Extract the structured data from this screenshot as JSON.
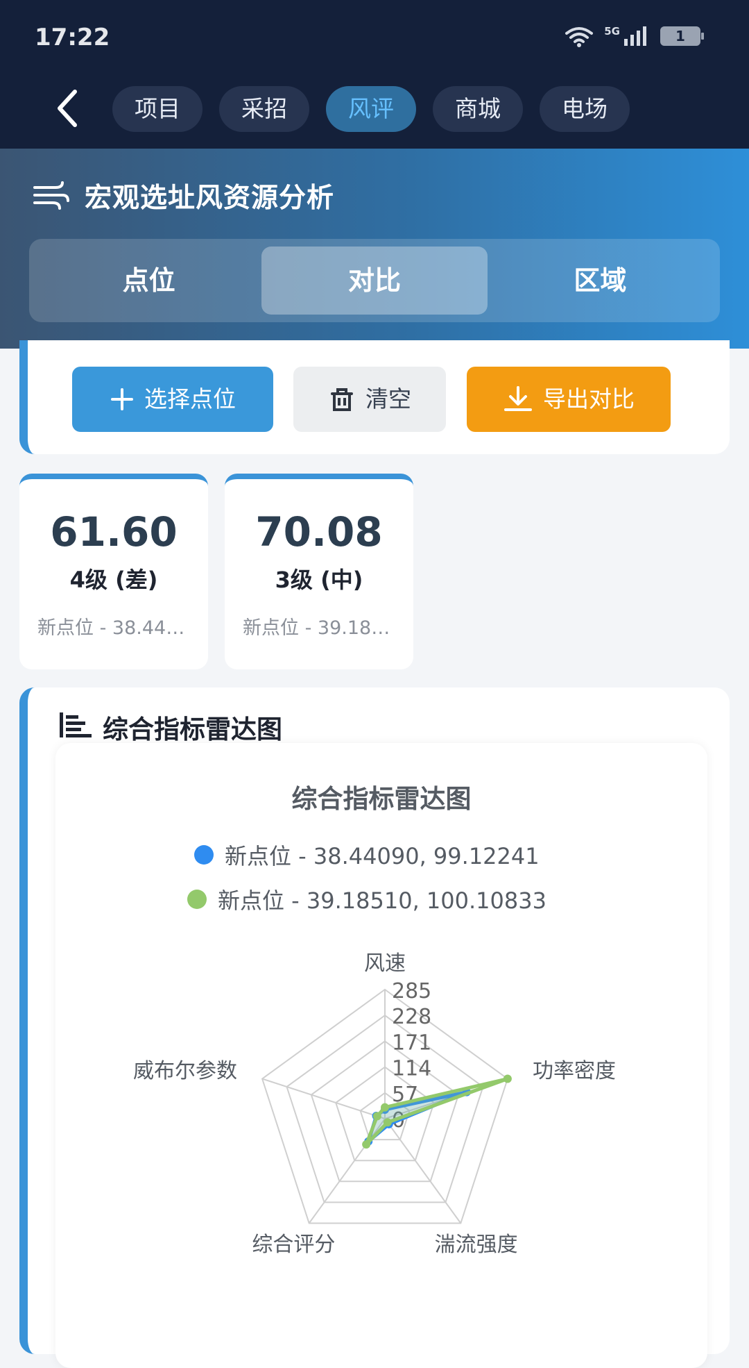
{
  "status": {
    "time": "17:22",
    "network": "5G",
    "battery": "1"
  },
  "nav": {
    "tabs": [
      {
        "label": "项目"
      },
      {
        "label": "采招"
      },
      {
        "label": "风评"
      },
      {
        "label": "商城"
      },
      {
        "label": "电场"
      }
    ],
    "active_tab": "风评"
  },
  "header": {
    "title": "宏观选址风资源分析",
    "segments": [
      {
        "label": "点位"
      },
      {
        "label": "对比"
      },
      {
        "label": "区域"
      }
    ],
    "active_segment": "对比"
  },
  "actions": {
    "select_label": "选择点位",
    "clear_label": "清空",
    "export_label": "导出对比"
  },
  "scores": [
    {
      "value": "61.60",
      "level": "4级 (差)",
      "name": "新点位 - 38.44090, 99.12241"
    },
    {
      "value": "70.08",
      "level": "3级 (中)",
      "name": "新点位 - 39.18510, 100.10833"
    }
  ],
  "radar_section": {
    "title": "综合指标雷达图"
  },
  "colors": {
    "accent": "#3a93d8",
    "series1": "#2f8cf0",
    "series2": "#93c96b",
    "export": "#f39c12"
  },
  "chart_data": {
    "type": "radar",
    "title": "综合指标雷达图",
    "indicators": [
      "风速",
      "功率密度",
      "湍流强度",
      "综合评分",
      "威布尔参数"
    ],
    "scale_max": 285,
    "tick_labels": [
      "0",
      "57",
      "114",
      "171",
      "228",
      "285"
    ],
    "series": [
      {
        "name": "新点位 - 38.44090, 99.12241",
        "values": [
          20,
          190,
          15,
          62,
          20
        ]
      },
      {
        "name": "新点位 - 39.18510, 100.10833",
        "values": [
          25,
          285,
          10,
          70,
          18
        ]
      }
    ]
  }
}
